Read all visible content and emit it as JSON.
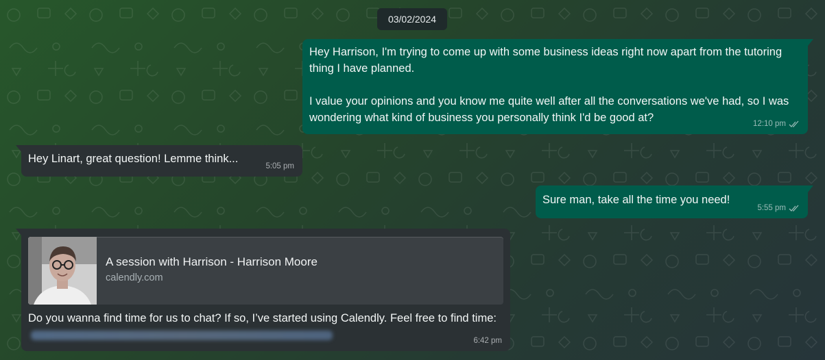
{
  "chat": {
    "date_chip": "03/02/2024",
    "messages": [
      {
        "direction": "outgoing",
        "text": "Hey Harrison, I'm trying to come up with some business ideas right now apart from the tutoring thing I have planned.\n\nI value your opinions and you know me quite well after all the conversations we've had, so I was wondering what kind of business you personally think I'd be good at?",
        "time": "12:10 pm",
        "status_icon": "double-check-icon"
      },
      {
        "direction": "incoming",
        "text": "Hey Linart, great question! Lemme think...",
        "time": "5:05 pm"
      },
      {
        "direction": "outgoing",
        "text": "Sure man, take all the time you need!",
        "time": "5:55 pm",
        "status_icon": "double-check-icon"
      },
      {
        "direction": "incoming",
        "link_preview": {
          "title": "A session with Harrison - Harrison Moore",
          "domain": "calendly.com",
          "thumbnail": "profile-photo"
        },
        "text": "Do you wanna find time for us to chat? If so, I’ve started using Calendly. Feel free to find time:",
        "link_blurred": true,
        "time": "6:42 pm"
      }
    ]
  },
  "colors": {
    "outgoing_bubble": "#005c4b",
    "incoming_bubble": "#2b3134",
    "date_chip": "#1f2a2b",
    "text": "#e9edef"
  }
}
